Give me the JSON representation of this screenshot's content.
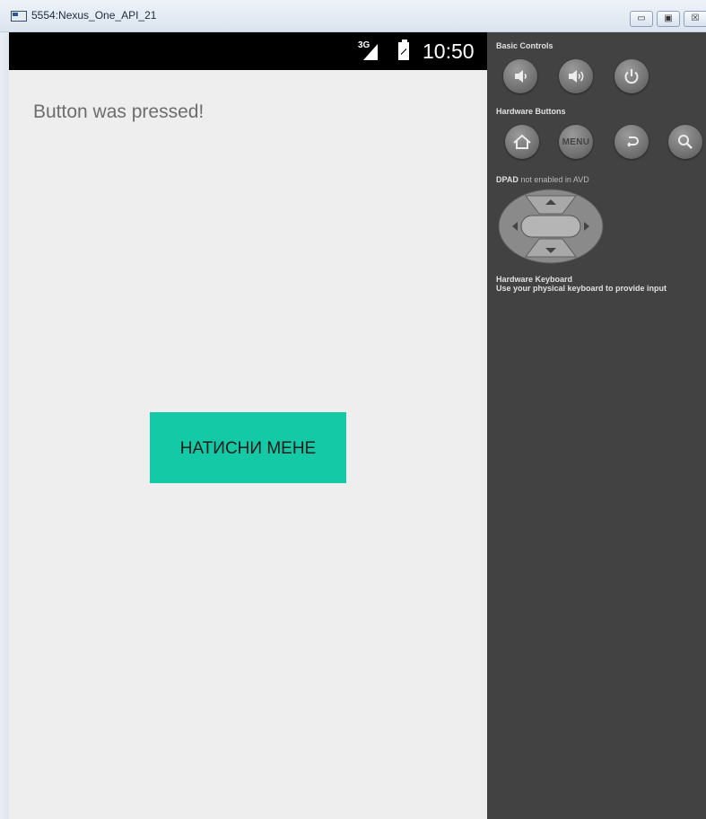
{
  "window": {
    "title": "5554:Nexus_One_API_21",
    "controls": {
      "minimize": "▭",
      "maximize": "▣",
      "close": "☒"
    }
  },
  "status_bar": {
    "network_label": "3G",
    "time": "10:50"
  },
  "app": {
    "message": "Button was pressed!",
    "button_label": "НАТИСНИ МЕНЕ",
    "button_color": "#13c9a6"
  },
  "control_panel": {
    "basic_controls_label": "Basic Controls",
    "basic_controls": [
      "volume-down-icon",
      "volume-up-icon",
      "power-icon"
    ],
    "hardware_buttons_label": "Hardware Buttons",
    "hardware_buttons": [
      "home-icon",
      "menu-button",
      "back-icon",
      "search-icon"
    ],
    "menu_label": "MENU",
    "dpad_label": "DPAD",
    "dpad_note": "not enabled in AVD",
    "keyboard_label": "Hardware Keyboard",
    "keyboard_note": "Use your physical keyboard to provide input"
  }
}
